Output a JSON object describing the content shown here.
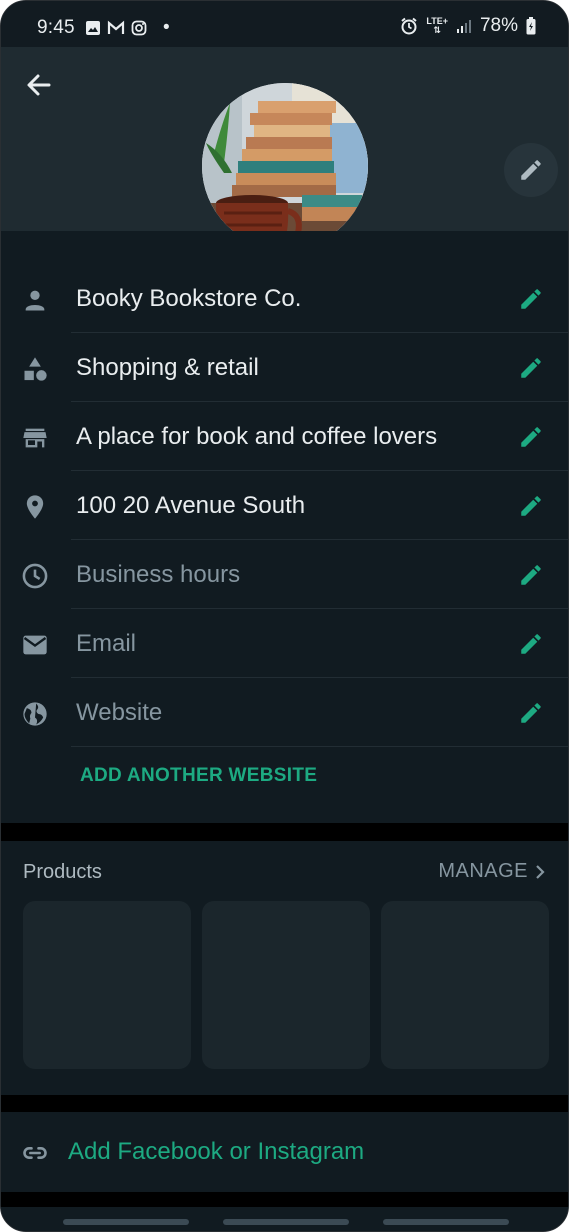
{
  "status_bar": {
    "time": "9:45",
    "dot": "•",
    "network": "LTE+",
    "battery": "78%"
  },
  "profile": {
    "rows": [
      {
        "icon": "person-icon",
        "text": "Booky Bookstore Co.",
        "muted": false
      },
      {
        "icon": "category-icon",
        "text": "Shopping & retail",
        "muted": false
      },
      {
        "icon": "store-icon",
        "text": "A place for book and coffee lovers",
        "muted": false
      },
      {
        "icon": "location-icon",
        "text": "100 20 Avenue South",
        "muted": false
      },
      {
        "icon": "clock-icon",
        "text": "Business hours",
        "muted": true
      },
      {
        "icon": "email-icon",
        "text": "Email",
        "muted": true
      },
      {
        "icon": "globe-icon",
        "text": "Website",
        "muted": true
      }
    ],
    "add_website": "ADD ANOTHER WEBSITE"
  },
  "products": {
    "title": "Products",
    "manage": "MANAGE"
  },
  "social": {
    "link_text": "Add Facebook or Instagram"
  },
  "colors": {
    "accent": "#1daa82",
    "background": "#111b21",
    "header": "#1f2b31",
    "text": "#e9edef",
    "muted": "#8696a0"
  }
}
